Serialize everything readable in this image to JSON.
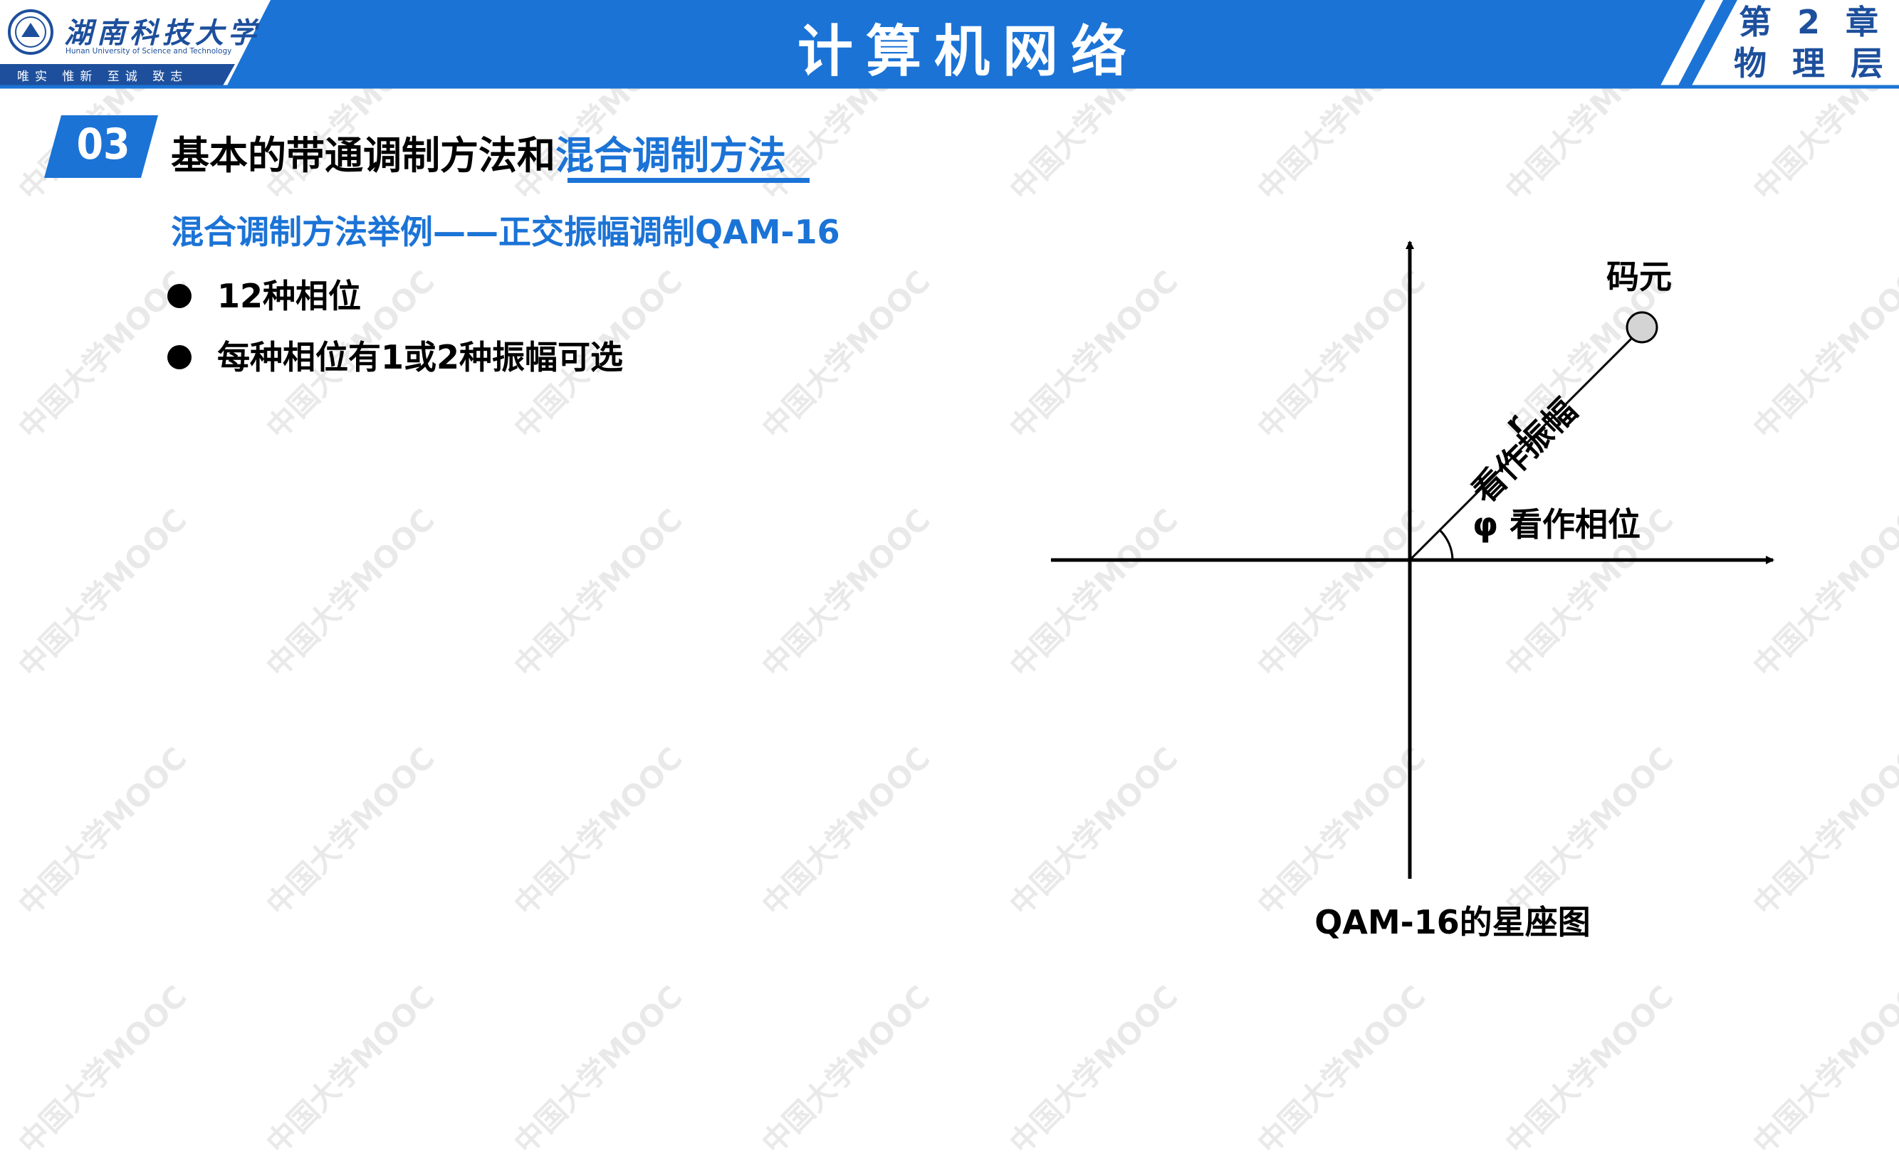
{
  "watermark_text": "中国大学MOOC",
  "header": {
    "university_name": "湖南科技大学",
    "university_name_en": "Hunan University of Science and Technology",
    "motto": "唯实 惟新  至诚 致志",
    "course_title": "计算机网络",
    "chapter_line1": "第 2 章",
    "chapter_line2": "物 理 层",
    "colors": {
      "banner_blue": "#1b73d6",
      "accent_blue": "#1d4f9c"
    }
  },
  "section": {
    "number": "03",
    "title_plain": "基本的带通调制方法和",
    "title_highlight": "混合调制方法"
  },
  "subtitle": "混合调制方法举例——正交振幅调制QAM-16",
  "bullets": [
    "12种相位",
    "每种相位有1或2种振幅可选"
  ],
  "diagram": {
    "symbol_label": "码元",
    "amplitude_label": "看作振幅",
    "r_label": "r",
    "phase_label": "φ 看作相位",
    "caption": "QAM-16的星座图"
  }
}
